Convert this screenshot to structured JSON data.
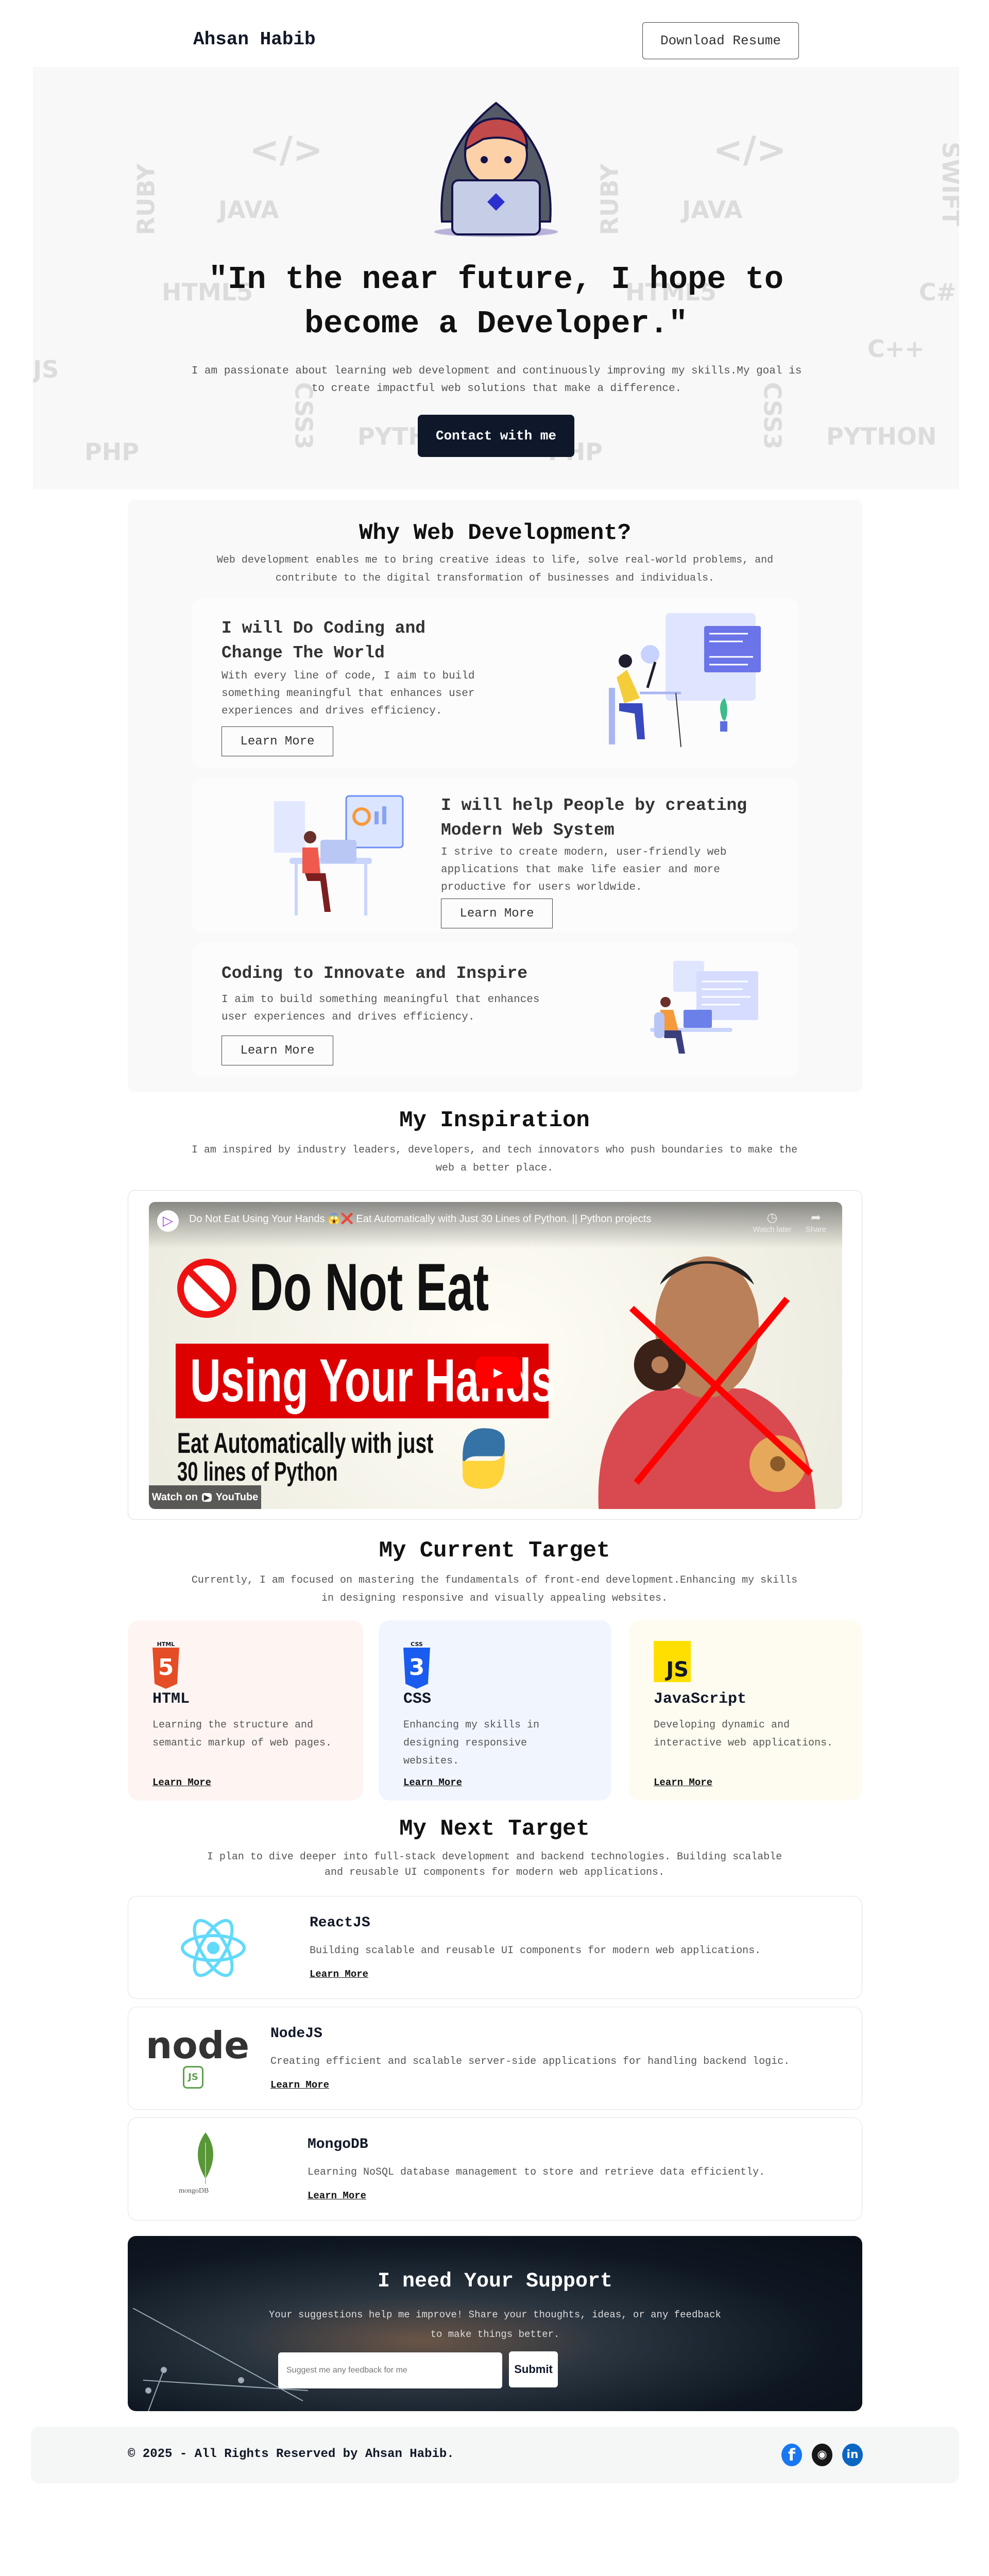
{
  "header": {
    "brand": "Ahsan Habib",
    "resume_button": "Download Resume"
  },
  "hero": {
    "doodles": [
      "JAVA",
      "PHP",
      "</>",
      "RUBY",
      "HTML5",
      "CSS3",
      "PYTHON",
      "C++",
      "C#",
      "JS",
      "{ }",
      "SWIFT"
    ],
    "heading": "\"In the near future, I hope to become a Developer.\"",
    "paragraph": "I am passionate about learning web development and continuously improving my skills.My goal is to create impactful web solutions that make a difference.",
    "contact_button": "Contact with me"
  },
  "why": {
    "title": "Why Web Development?",
    "paragraph": "Web development enables me to bring creative ideas to life, solve real-world problems, and contribute to the digital transformation of businesses and individuals.",
    "cards": [
      {
        "title": "I will Do Coding and Change The World",
        "text": "With every line of code, I aim to build something meaningful that enhances user experiences and drives efficiency.",
        "button": "Learn More"
      },
      {
        "title": "I will help People by creating Modern Web System",
        "text": "I strive to create modern, user-friendly web applications that make life easier and more productive for users worldwide.",
        "button": "Learn More"
      },
      {
        "title": "Coding to Innovate and Inspire",
        "text": "I aim to build something meaningful that enhances user experiences and drives efficiency.",
        "button": "Learn More"
      }
    ]
  },
  "inspiration": {
    "title": "My Inspiration",
    "paragraph": "I am inspired by industry leaders, developers, and tech innovators who push boundaries to make the web a better place.",
    "video": {
      "title": "Do Not Eat Using Your Hands 😱❌ Eat Automatically with Just 30 Lines of Python. || Python projects",
      "watch_later": "Watch later",
      "share": "Share",
      "thumb_line1": "Do Not Eat",
      "thumb_line2": "Using Your Hands",
      "thumb_line3": "Eat Automatically with just",
      "thumb_line4": "30 lines of Python",
      "watch_on": "Watch on",
      "youtube": "YouTube"
    }
  },
  "current": {
    "title": "My Current Target",
    "paragraph": "Currently, I am focused on mastering the fundamentals of front-end development.Enhancing my skills in designing responsive and visually appealing websites.",
    "cards": [
      {
        "badge": "HTML",
        "icon_text": "5",
        "title": "HTML",
        "text": "Learning the structure and semantic markup of web pages.",
        "link": "Learn More",
        "bg": "#fef5f3"
      },
      {
        "badge": "CSS",
        "icon_text": "3",
        "title": "CSS",
        "text": "Enhancing my skills in designing responsive websites.",
        "link": "Learn More",
        "bg": "#f1f6fe"
      },
      {
        "badge": "",
        "icon_text": "JS",
        "title": "JavaScript",
        "text": "Developing dynamic and interactive web applications.",
        "link": "Learn More",
        "bg": "#fefcf1"
      }
    ]
  },
  "next": {
    "title": "My Next Target",
    "paragraph": "I plan to dive deeper into full-stack development and backend technologies. Building scalable and reusable UI components for modern web applications.",
    "cards": [
      {
        "title": "ReactJS",
        "text": "Building scalable and reusable UI components for modern web applications.",
        "link": "Learn More"
      },
      {
        "title": "NodeJS",
        "logo_text": "node",
        "text": "Creating efficient and scalable server-side applications for handling backend logic.",
        "link": "Learn More"
      },
      {
        "title": "MongoDB",
        "logo_text": "mongoDB",
        "text": "Learning NoSQL database management to store and retrieve data efficiently.",
        "link": "Learn More"
      }
    ]
  },
  "support": {
    "title": "I need Your Support",
    "paragraph": "Your suggestions help me improve! Share your thoughts, ideas, or any feedback to make things better.",
    "placeholder": "Suggest me any feedback for me",
    "submit": "Submit"
  },
  "footer": {
    "copyright": "© 2025 - All Rights Reserved by Ahsan Habib.",
    "social": [
      "facebook-icon",
      "github-icon",
      "linkedin-icon"
    ]
  },
  "colors": {
    "dark": "#0f172a",
    "facebook": "#1877f2",
    "linkedin": "#0a66c2",
    "html": "#e44d26",
    "css": "#1572b6",
    "js": "#f7df1e",
    "react": "#61dafb",
    "node": "#5fa04e",
    "mongo": "#589636"
  }
}
